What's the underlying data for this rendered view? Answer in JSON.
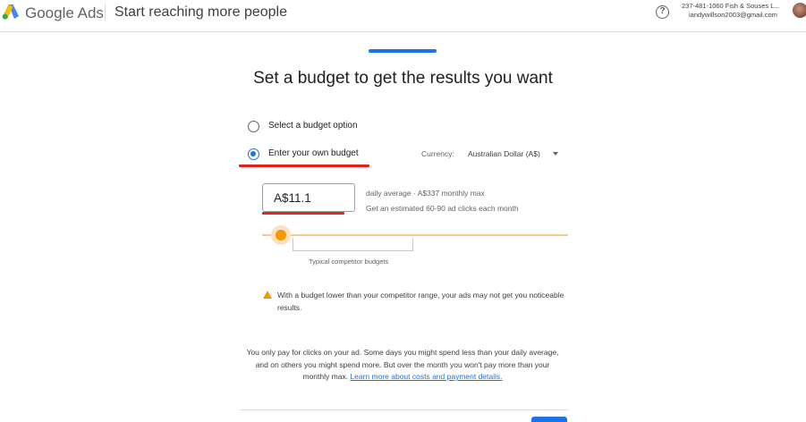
{
  "header": {
    "brand": "Google Ads",
    "page_title": "Start reaching more people",
    "help_icon": "help-circle-icon",
    "account_name": "237-481-1060 Fish & Souses L...",
    "account_email": "iandywillson2003@gmail.com"
  },
  "main": {
    "heading": "Set a budget to get the results you want",
    "options": [
      {
        "label": "Select a budget option",
        "selected": false
      },
      {
        "label": "Enter your own budget",
        "selected": true
      }
    ],
    "currency_label": "Currency:",
    "currency_value": "Australian Dollar (A$)",
    "budget_value": "A$11.1",
    "daily_summary": "daily average  ·  A$337 monthly max",
    "estimate": "Get an estimated 60-90 ad clicks each month",
    "competitor_label": "Typical competitor budgets",
    "warning": "With a budget lower than your competitor range, your ads may not get you noticeable results.",
    "pay_note": "You only pay for clicks on your ad. Some days you might spend less than your daily average, and on others you might spend more. But over the month you won't pay more than your monthly max.",
    "learn_more": "Learn more about costs and payment details."
  },
  "colors": {
    "accent": "#1a73e8",
    "slider": "#f29900",
    "warning": "#f29900",
    "annotation_red": "#e8201a"
  }
}
